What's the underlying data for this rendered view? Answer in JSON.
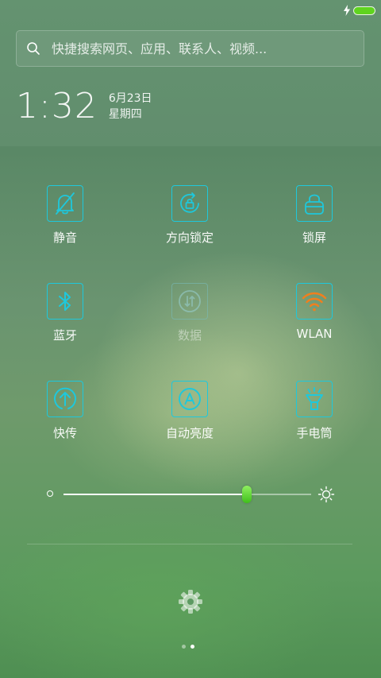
{
  "search": {
    "placeholder": "快捷搜索网页、应用、联系人、视频..."
  },
  "clock": {
    "time": "1:32",
    "date": "6月23日",
    "weekday": "星期四"
  },
  "toggles": [
    {
      "label": "静音",
      "icon": "bell-off-icon",
      "active": true
    },
    {
      "label": "方向锁定",
      "icon": "rotation-lock-icon",
      "active": true
    },
    {
      "label": "锁屏",
      "icon": "lock-icon",
      "active": true
    },
    {
      "label": "蓝牙",
      "icon": "bluetooth-icon",
      "active": true
    },
    {
      "label": "数据",
      "icon": "mobile-data-icon",
      "active": false
    },
    {
      "label": "WLAN",
      "icon": "wifi-icon",
      "active": true
    },
    {
      "label": "快传",
      "icon": "quick-transfer-icon",
      "active": true
    },
    {
      "label": "自动亮度",
      "icon": "auto-brightness-icon",
      "active": true
    },
    {
      "label": "手电筒",
      "icon": "flashlight-icon",
      "active": true
    }
  ],
  "brightness": {
    "level": 0.74
  },
  "pager": {
    "count": 2,
    "active_index": 1
  },
  "colors": {
    "accent": "#1ec8dc",
    "wifi": "#f07f1e",
    "battery": "#5fd41f",
    "slider_thumb": "#4fcf24"
  }
}
